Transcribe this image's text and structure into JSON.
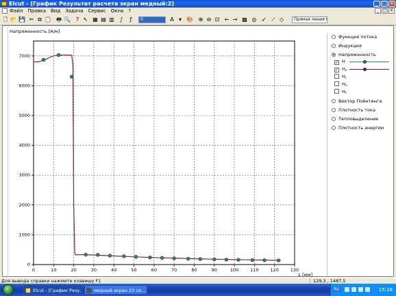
{
  "window": {
    "title": "Elcut - [График Результат расчета экран  медный:2]",
    "minimize_label": "_",
    "maximize_label": "□",
    "close_label": "×"
  },
  "menu": [
    "Файл",
    "Правка",
    "Вид",
    "Задача",
    "Сервис",
    "Окна",
    "?"
  ],
  "toolbar": {
    "combo1_value": "0",
    "combo2_value": "A",
    "combo3_value": "Прямая линия (0"
  },
  "chart_data": {
    "type": "line",
    "ylabel": "Напряженность [А/м]",
    "xlabel": "L [мм]",
    "xlim": [
      0,
      130
    ],
    "ylim": [
      0,
      7500
    ],
    "x_ticks": [
      0,
      10,
      20,
      30,
      40,
      50,
      60,
      70,
      80,
      90,
      100,
      110,
      120,
      130
    ],
    "y_ticks": [
      0,
      1000,
      2000,
      3000,
      4000,
      5000,
      6000,
      7000
    ],
    "grid": true,
    "series": [
      {
        "name": "H",
        "color": "#2e8b57",
        "x": [
          0,
          2,
          5,
          8,
          10,
          12,
          14,
          16,
          18,
          19,
          19.6,
          20,
          20.5,
          21,
          22,
          25,
          30,
          40,
          50,
          60,
          70,
          80,
          90,
          100,
          110,
          120,
          123
        ],
        "y": [
          6800,
          6800,
          6850,
          6950,
          7000,
          7020,
          7030,
          7030,
          7030,
          7020,
          6700,
          2000,
          400,
          320,
          330,
          330,
          320,
          290,
          260,
          235,
          215,
          195,
          180,
          165,
          155,
          145,
          140
        ]
      },
      {
        "name": "Hz",
        "color": "#b0004a",
        "x": [
          0,
          2,
          5,
          8,
          10,
          12,
          14,
          16,
          18,
          19,
          19.6,
          20,
          20.5,
          21,
          22,
          25,
          30,
          40,
          50,
          60,
          70,
          80,
          90,
          100,
          110,
          120,
          123
        ],
        "y": [
          6800,
          6800,
          6850,
          6950,
          7000,
          7020,
          7030,
          7030,
          7030,
          7020,
          6700,
          2000,
          400,
          320,
          330,
          330,
          320,
          290,
          260,
          235,
          215,
          195,
          180,
          165,
          155,
          145,
          140
        ]
      }
    ],
    "markers_x": [
      5,
      12.5,
      19,
      26,
      32,
      38,
      45,
      51,
      58,
      64,
      70,
      77,
      83,
      90,
      96,
      102,
      109,
      115,
      122
    ],
    "markers_y": [
      6870,
      7030,
      6300,
      330,
      325,
      300,
      280,
      260,
      240,
      225,
      210,
      195,
      185,
      175,
      165,
      160,
      150,
      145,
      140
    ]
  },
  "panel": {
    "options": [
      {
        "label": "Функция потока",
        "selected": false
      },
      {
        "label": "Индукция",
        "selected": false
      },
      {
        "label": "Напряженность",
        "selected": true
      },
      {
        "label": "Вектор Пойнтинга",
        "selected": false
      },
      {
        "label": "Плотность тока",
        "selected": false
      },
      {
        "label": "Тепловыделение",
        "selected": false
      },
      {
        "label": "Плотность энергии",
        "selected": false
      }
    ],
    "components": [
      {
        "label": "H",
        "sub": "",
        "checked": true
      },
      {
        "label": "H",
        "sub": "z",
        "checked": true
      },
      {
        "label": "H",
        "sub": "r",
        "checked": false
      },
      {
        "label": "H",
        "sub": "n",
        "checked": false
      },
      {
        "label": "H",
        "sub": "t",
        "checked": false
      }
    ],
    "check_mark": "✓"
  },
  "status": {
    "help_text": "Для вывода справки нажмите клавишу F1",
    "coords": "129,3 ,  1487,5"
  },
  "taskbar": {
    "tasks": [
      {
        "label": "Elcut - [График Резу...",
        "active": true
      },
      {
        "label": "медный экран 23 се...",
        "active": false
      }
    ],
    "lang": "RU",
    "clock": "15:16"
  }
}
